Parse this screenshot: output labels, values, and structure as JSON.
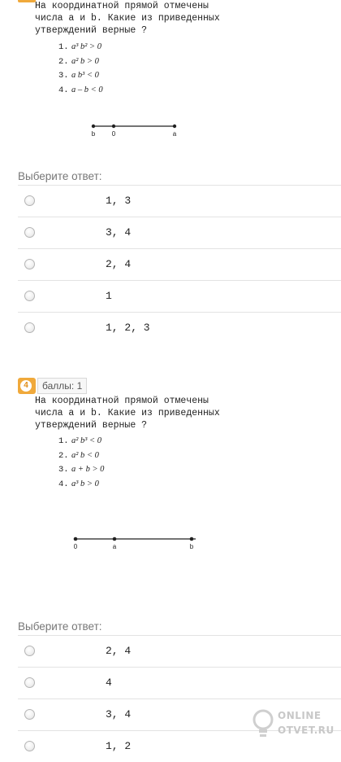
{
  "question3": {
    "text_lines": [
      "На координатной прямой отмечены",
      "числа a и b. Какие из приведенных",
      "утверждений верные ?"
    ],
    "statements": [
      {
        "num": "1.",
        "expr": "a³ b² > 0"
      },
      {
        "num": "2.",
        "expr": "a² b > 0"
      },
      {
        "num": "3.",
        "expr": "a b³ < 0"
      },
      {
        "num": "4.",
        "expr": "a – b < 0"
      }
    ],
    "number_line": {
      "labels": [
        "b",
        "0",
        "a"
      ]
    },
    "prompt": "Выберите ответ:",
    "options": [
      "1, 3",
      "3, 4",
      "2, 4",
      "1",
      "1, 2, 3"
    ]
  },
  "question4": {
    "badge_number": "4",
    "points_label": "баллы: 1",
    "text_lines": [
      "На координатной прямой отмечены",
      "числа a и b. Какие из приведенных",
      "утверждений верные ?"
    ],
    "statements": [
      {
        "num": "1.",
        "expr": "a² b³ < 0"
      },
      {
        "num": "2.",
        "expr": "a² b < 0"
      },
      {
        "num": "3.",
        "expr": "a + b > 0"
      },
      {
        "num": "4.",
        "expr": "a³ b > 0"
      }
    ],
    "number_line": {
      "labels": [
        "0",
        "a",
        "b"
      ]
    },
    "prompt": "Выберите ответ:",
    "options": [
      "2, 4",
      "4",
      "3, 4",
      "1, 2"
    ]
  },
  "watermark": {
    "line1": "ONLINE",
    "line2": "OTVET.RU"
  },
  "colors": {
    "badge": "#f0a93b",
    "prompt": "#777777",
    "divider": "#e3e3e3"
  }
}
